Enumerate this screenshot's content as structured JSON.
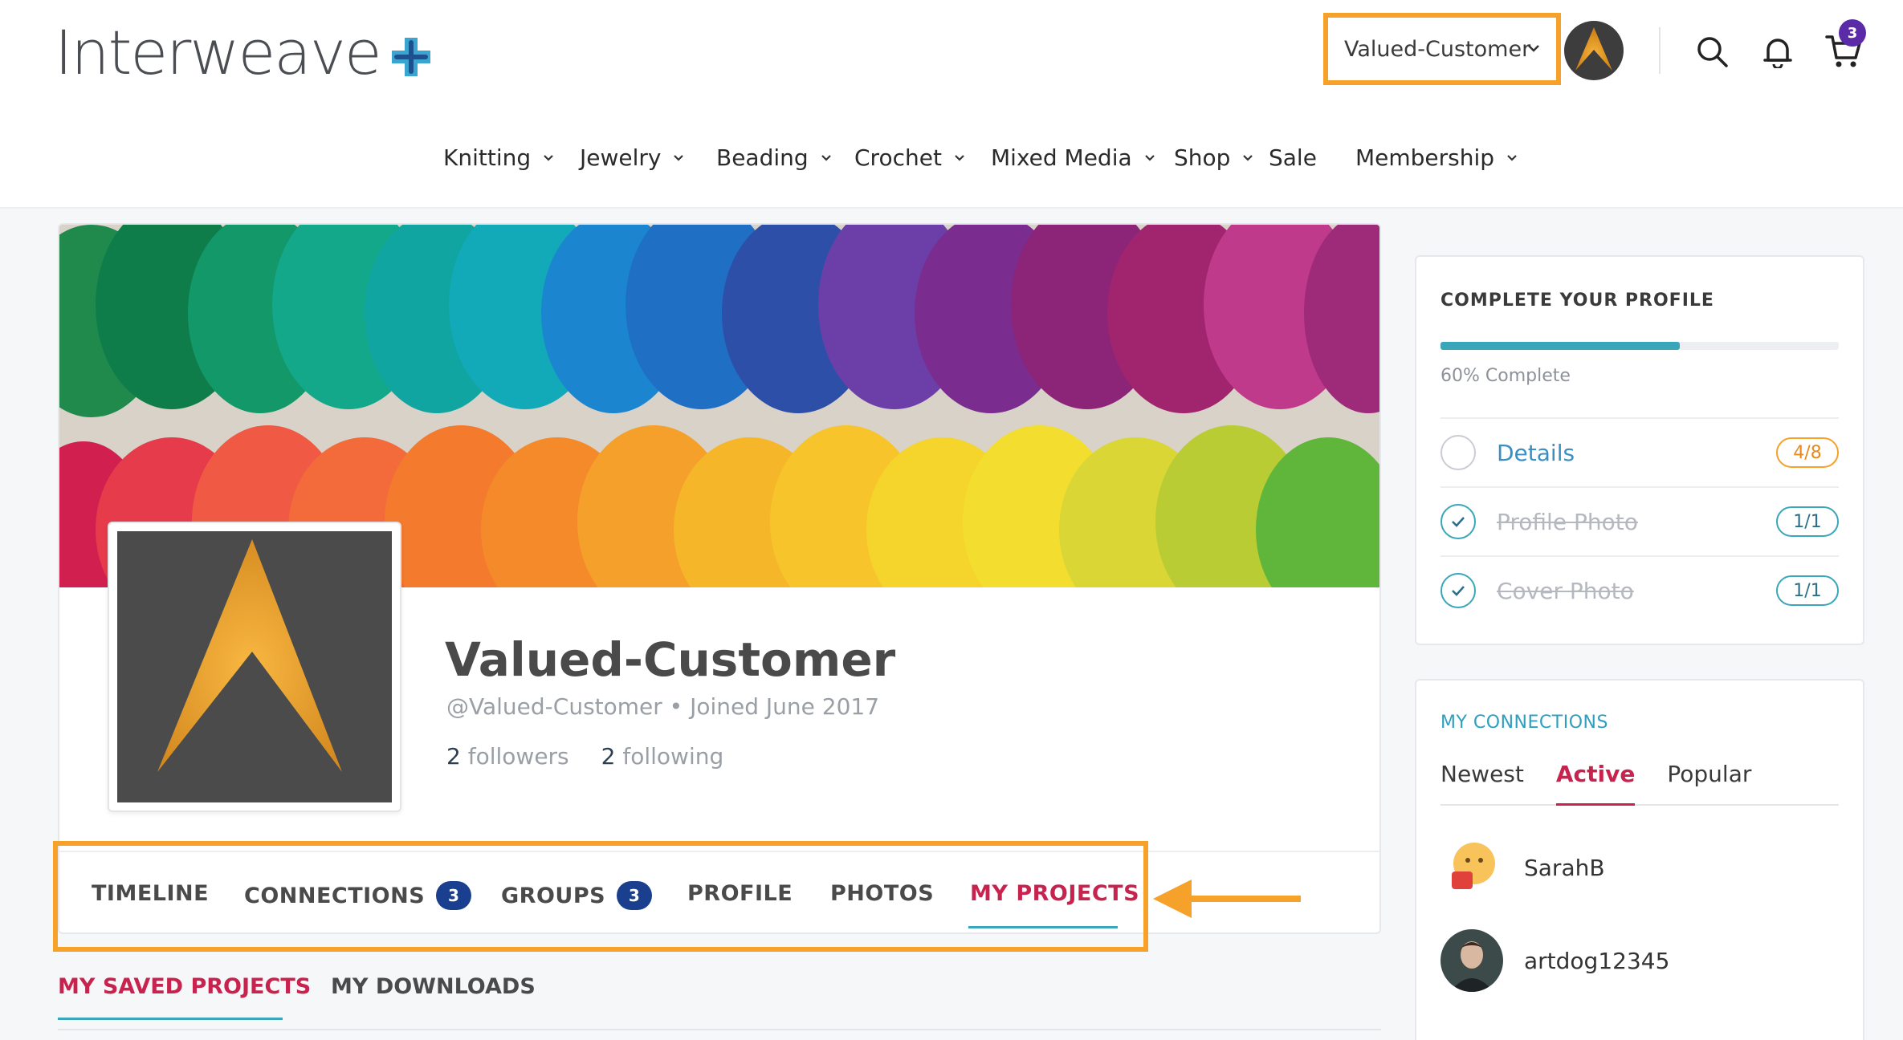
{
  "header": {
    "logo_text": "Interweave",
    "user_menu_label": "Valued-Customer",
    "cart_count": "3",
    "highlight_color": "#f6a12a"
  },
  "nav": {
    "items": [
      {
        "label": "Knitting",
        "has_dropdown": true
      },
      {
        "label": "Jewelry",
        "has_dropdown": true
      },
      {
        "label": "Beading",
        "has_dropdown": true
      },
      {
        "label": "Crochet",
        "has_dropdown": true
      },
      {
        "label": "Mixed Media",
        "has_dropdown": true
      },
      {
        "label": "Shop",
        "has_dropdown": true
      },
      {
        "label": "Sale",
        "has_dropdown": false
      },
      {
        "label": "Membership",
        "has_dropdown": true
      }
    ]
  },
  "profile": {
    "name": "Valued-Customer",
    "meta": "@Valued-Customer • Joined June 2017",
    "followers_count": "2",
    "followers_label": "followers",
    "following_count": "2",
    "following_label": "following"
  },
  "tabs": [
    {
      "label": "TIMELINE"
    },
    {
      "label": "CONNECTIONS",
      "count": "3"
    },
    {
      "label": "GROUPS",
      "count": "3"
    },
    {
      "label": "PROFILE"
    },
    {
      "label": "PHOTOS"
    },
    {
      "label": "MY PROJECTS",
      "active": true
    }
  ],
  "subtabs": [
    {
      "label": "MY SAVED PROJECTS",
      "active": true
    },
    {
      "label": "MY DOWNLOADS"
    }
  ],
  "complete_profile": {
    "title": "COMPLETE YOUR PROFILE",
    "progress_percent": 60,
    "progress_label": "60% Complete",
    "steps": [
      {
        "label": "Details",
        "badge": "4/8",
        "done": false
      },
      {
        "label": "Profile Photo",
        "badge": "1/1",
        "done": true
      },
      {
        "label": "Cover Photo",
        "badge": "1/1",
        "done": true
      }
    ]
  },
  "connections": {
    "title": "MY CONNECTIONS",
    "tabs": [
      {
        "label": "Newest"
      },
      {
        "label": "Active",
        "active": true
      },
      {
        "label": "Popular"
      }
    ],
    "people": [
      {
        "name": "SarahB"
      },
      {
        "name": "artdog12345"
      }
    ]
  }
}
